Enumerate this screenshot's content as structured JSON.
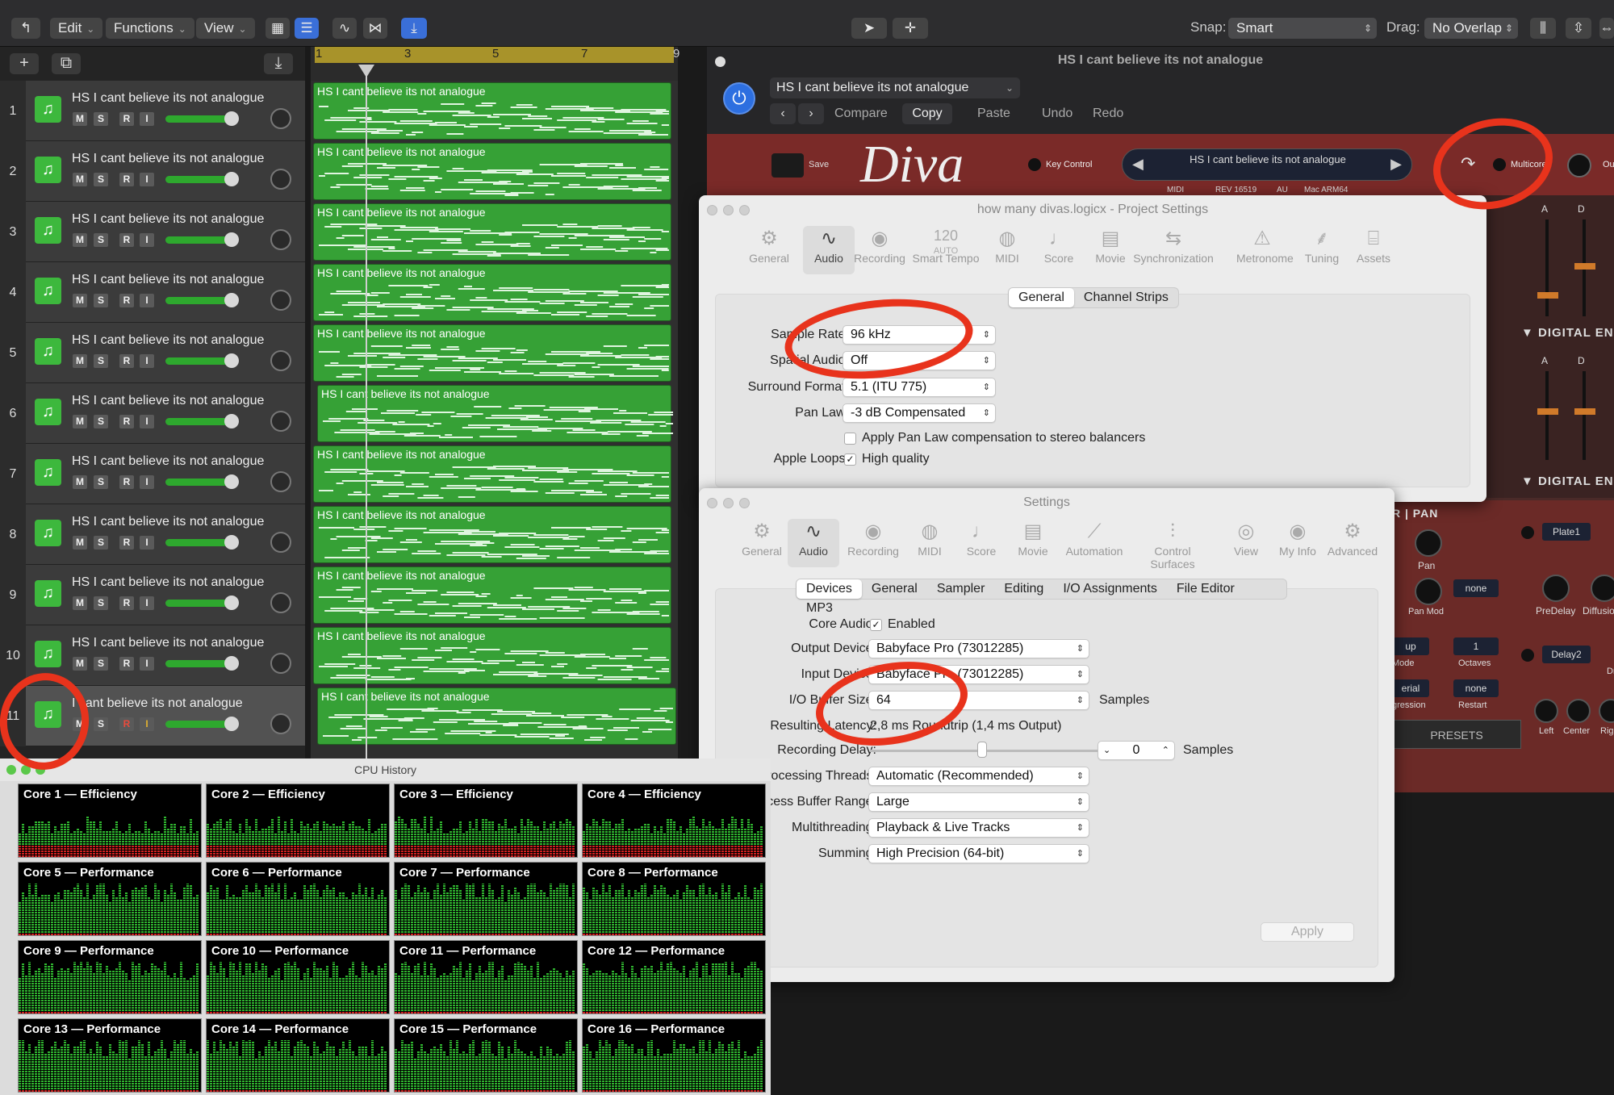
{
  "toolbar": {
    "menus": [
      "Edit",
      "Functions",
      "View"
    ],
    "snap_label": "Snap:",
    "snap_value": "Smart",
    "drag_label": "Drag:",
    "drag_value": "No Overlap"
  },
  "ruler": {
    "bars": [
      "1",
      "3",
      "5",
      "7",
      "9"
    ]
  },
  "tracks": [
    {
      "num": "1",
      "name": "HS I cant believe its not analogue"
    },
    {
      "num": "2",
      "name": "HS I cant believe its not analogue"
    },
    {
      "num": "3",
      "name": "HS I cant believe its not analogue"
    },
    {
      "num": "4",
      "name": "HS I cant believe its not analogue"
    },
    {
      "num": "5",
      "name": "HS I cant believe its not analogue"
    },
    {
      "num": "6",
      "name": "HS I cant believe its not analogue"
    },
    {
      "num": "7",
      "name": "HS I cant believe its not analogue"
    },
    {
      "num": "8",
      "name": "HS I cant believe its not analogue"
    },
    {
      "num": "9",
      "name": "HS I cant believe its not analogue"
    },
    {
      "num": "10",
      "name": "HS I cant believe its not analogue"
    },
    {
      "num": "11",
      "name": "I cant believe its not analogue"
    }
  ],
  "track_buttons": [
    "M",
    "S",
    "R",
    "I"
  ],
  "regions": [
    "HS I cant believe its not analogue",
    "HS I cant believe its not analogue",
    "HS I cant believe its not analogue",
    "HS I cant believe its not analogue",
    "HS I cant believe its not analogue",
    "HS I cant believe its not analogue",
    "HS I cant believe its not analogue",
    "HS I cant believe its not analogue",
    "HS I cant believe its not analogue",
    "HS I cant believe its not analogue",
    "HS I cant believe its not analogue"
  ],
  "plugin": {
    "window_title": "HS I cant believe its not analogue",
    "preset": "HS I cant believe its not analogue",
    "compare": "Compare",
    "copy": "Copy",
    "paste": "Paste",
    "undo": "Undo",
    "redo": "Redo",
    "save": "Save",
    "logo": "Diva",
    "key_control": "Key Control",
    "patch_name": "HS I cant believe its not analogue",
    "midi": "MIDI",
    "rev": "REV 16519",
    "au": "AU",
    "arch": "Mac ARM64",
    "multicore": "Multicore",
    "out": "Ou",
    "env_a": "A",
    "env_d": "D",
    "digital_env_1": "▼ DIGITAL EN",
    "digital_env_2": "▼ DIGITAL EN",
    "pan_header": "R | PAN",
    "plate": "Plate1",
    "pan": "Pan",
    "pan_mod": "Pan Mod",
    "none1": "none",
    "predelay": "PreDelay",
    "diffusion": "Diffusio",
    "up": "up",
    "mode": "Mode",
    "one": "1",
    "octaves": "Octaves",
    "delay2": "Delay2",
    "dr": "Dr",
    "serial": "erial",
    "gression": "gression",
    "none2": "none",
    "restart": "Restart",
    "presets": "PRESETS",
    "left": "Left",
    "center": "Center",
    "right": "Rig"
  },
  "project_settings": {
    "title": "how many divas.logicx - Project Settings",
    "tabs": [
      "General",
      "Audio",
      "Recording",
      "Smart Tempo",
      "MIDI",
      "Score",
      "Movie",
      "Synchronization",
      "Metronome",
      "Tuning",
      "Assets"
    ],
    "tempo_value": "120",
    "tempo_mode": "AUTO",
    "segments": [
      "General",
      "Channel Strips"
    ],
    "sample_rate_label": "Sample Rate:",
    "sample_rate": "96 kHz",
    "spatial_label": "Spatial Audio:",
    "spatial": "Off",
    "surround_label": "Surround Format:",
    "surround": "5.1 (ITU 775)",
    "panlaw_label": "Pan Law:",
    "panlaw": "-3 dB Compensated",
    "panlaw_comp": "Apply Pan Law compensation to stereo balancers",
    "apple_loops_label": "Apple Loops:",
    "apple_loops": "High quality"
  },
  "settings": {
    "title": "Settings",
    "tabs": [
      "General",
      "Audio",
      "Recording",
      "MIDI",
      "Score",
      "Movie",
      "Automation",
      "Control Surfaces",
      "View",
      "My Info",
      "Advanced"
    ],
    "segments": [
      "Devices",
      "General",
      "Sampler",
      "Editing",
      "I/O Assignments",
      "File Editor",
      "MP3"
    ],
    "core_audio_label": "Core Audio:",
    "core_audio": "Enabled",
    "output_label": "Output Device:",
    "output": "Babyface Pro (73012285)",
    "input_label": "Input Device:",
    "input": "Babyface Pro (73012285)",
    "buffer_label": "I/O Buffer Size:",
    "buffer": "64",
    "samples": "Samples",
    "latency_label": "Resulting Latency:",
    "latency": "2,8 ms Roundtrip (1,4 ms Output)",
    "rec_delay_label": "Recording Delay:",
    "rec_delay": "0",
    "threads_label": "Processing Threads:",
    "threads": "Automatic (Recommended)",
    "process_buffer_label": "Process Buffer Range:",
    "process_buffer": "Large",
    "multithreading_label": "Multithreading:",
    "multithreading": "Playback & Live Tracks",
    "summing_label": "Summing:",
    "summing": "High Precision (64-bit)",
    "apply": "Apply"
  },
  "cpu": {
    "title": "CPU History",
    "cores": [
      "Core 1 — Efficiency",
      "Core 2 — Efficiency",
      "Core 3 — Efficiency",
      "Core 4 — Efficiency",
      "Core 5 — Performance",
      "Core 6 — Performance",
      "Core 7 — Performance",
      "Core 8 — Performance",
      "Core 9 — Performance",
      "Core 10 — Performance",
      "Core 11 — Performance",
      "Core 12 — Performance",
      "Core 13 — Performance",
      "Core 14 — Performance",
      "Core 15 — Performance",
      "Core 16 — Performance"
    ]
  },
  "colors": {
    "accent": "#3db83d",
    "annotation": "#e8331c",
    "cycle": "#a8932a"
  }
}
